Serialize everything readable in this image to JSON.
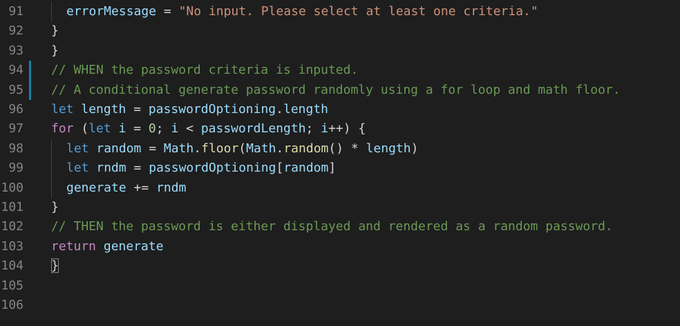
{
  "editor": {
    "lines": [
      {
        "n": "91",
        "indent": 1,
        "modified": false,
        "tokens": [
          [
            "var",
            "errorMessage"
          ],
          [
            "punc",
            " = "
          ],
          [
            "str",
            "\"No input. Please select at least one criteria.\""
          ]
        ]
      },
      {
        "n": "92",
        "indent": 0,
        "modified": false,
        "tokens": [
          [
            "punc",
            "}"
          ]
        ]
      },
      {
        "n": "93",
        "indent": 0,
        "modified": false,
        "tokens": [
          [
            "punc",
            "}"
          ]
        ]
      },
      {
        "n": "94",
        "indent": 0,
        "modified": true,
        "tokens": [
          [
            "cmt",
            "// WHEN the password criteria is inputed."
          ]
        ]
      },
      {
        "n": "95",
        "indent": 0,
        "modified": true,
        "tokens": [
          [
            "cmt",
            "// A conditional generate password randomly using a for loop and math floor."
          ]
        ]
      },
      {
        "n": "96",
        "indent": 0,
        "modified": false,
        "tokens": [
          [
            "kw",
            "let"
          ],
          [
            "punc",
            " "
          ],
          [
            "var",
            "length"
          ],
          [
            "punc",
            " = "
          ],
          [
            "var",
            "passwordOptioning"
          ],
          [
            "punc",
            "."
          ],
          [
            "var",
            "length"
          ]
        ]
      },
      {
        "n": "97",
        "indent": 0,
        "modified": false,
        "tokens": [
          [
            "ctl",
            "for"
          ],
          [
            "punc",
            " ("
          ],
          [
            "kw",
            "let"
          ],
          [
            "punc",
            " "
          ],
          [
            "var",
            "i"
          ],
          [
            "punc",
            " = "
          ],
          [
            "num",
            "0"
          ],
          [
            "punc",
            "; "
          ],
          [
            "var",
            "i"
          ],
          [
            "punc",
            " < "
          ],
          [
            "var",
            "passwordLength"
          ],
          [
            "punc",
            "; "
          ],
          [
            "var",
            "i"
          ],
          [
            "punc",
            "++) {"
          ]
        ]
      },
      {
        "n": "98",
        "indent": 1,
        "modified": false,
        "tokens": [
          [
            "kw",
            "let"
          ],
          [
            "punc",
            " "
          ],
          [
            "var",
            "random"
          ],
          [
            "punc",
            " = "
          ],
          [
            "var",
            "Math"
          ],
          [
            "punc",
            "."
          ],
          [
            "fn",
            "floor"
          ],
          [
            "punc",
            "("
          ],
          [
            "var",
            "Math"
          ],
          [
            "punc",
            "."
          ],
          [
            "fn",
            "random"
          ],
          [
            "punc",
            "() * "
          ],
          [
            "var",
            "length"
          ],
          [
            "punc",
            ")"
          ]
        ]
      },
      {
        "n": "99",
        "indent": 1,
        "modified": false,
        "tokens": [
          [
            "kw",
            "let"
          ],
          [
            "punc",
            " "
          ],
          [
            "var",
            "rndm"
          ],
          [
            "punc",
            " = "
          ],
          [
            "var",
            "passwordOptioning"
          ],
          [
            "punc",
            "["
          ],
          [
            "var",
            "random"
          ],
          [
            "punc",
            "]"
          ]
        ]
      },
      {
        "n": "100",
        "indent": 1,
        "modified": false,
        "tokens": [
          [
            "var",
            "generate"
          ],
          [
            "punc",
            " += "
          ],
          [
            "var",
            "rndm"
          ]
        ]
      },
      {
        "n": "101",
        "indent": 0,
        "modified": false,
        "tokens": [
          [
            "punc",
            "}"
          ]
        ]
      },
      {
        "n": "102",
        "indent": 0,
        "modified": false,
        "tokens": [
          [
            "cmt",
            "// THEN the password is either displayed and rendered as a random password."
          ]
        ]
      },
      {
        "n": "103",
        "indent": 0,
        "modified": false,
        "tokens": [
          [
            "ctl",
            "return"
          ],
          [
            "punc",
            " "
          ],
          [
            "var",
            "generate"
          ]
        ]
      },
      {
        "n": "104",
        "indent": 0,
        "modified": false,
        "tokens": [
          [
            "match",
            "}"
          ]
        ]
      },
      {
        "n": "105",
        "indent": 0,
        "modified": false,
        "tokens": []
      },
      {
        "n": "106",
        "indent": 0,
        "modified": false,
        "tokens": []
      }
    ]
  },
  "theme": {
    "background": "#1e1e1e",
    "line_number": "#858585",
    "variable": "#9cdcfe",
    "string": "#ce9178",
    "comment": "#6a9955",
    "keyword": "#569cd6",
    "control": "#c586c0",
    "function": "#dcdcaa",
    "number": "#b5cea8",
    "modified_bar": "#1b81a8"
  }
}
